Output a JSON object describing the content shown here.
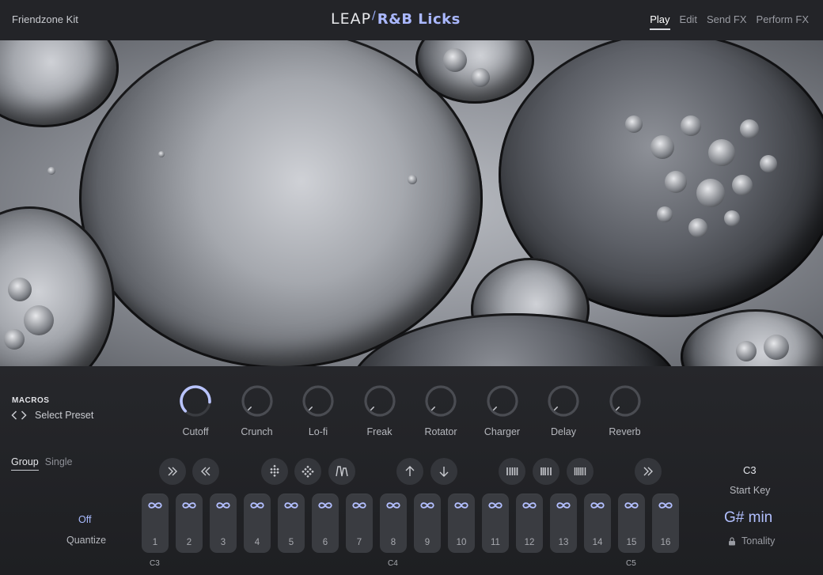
{
  "header": {
    "kit_name": "Friendzone Kit",
    "logo_brand": "LEAP",
    "logo_title": "R&B Licks",
    "nav_tabs": [
      {
        "label": "Play",
        "active": true
      },
      {
        "label": "Edit",
        "active": false
      },
      {
        "label": "Send FX",
        "active": false
      },
      {
        "label": "Perform FX",
        "active": false
      }
    ]
  },
  "macros": {
    "label": "MACROS",
    "preset_label": "Select Preset",
    "knobs": [
      {
        "label": "Cutoff",
        "value": 0.85
      },
      {
        "label": "Crunch",
        "value": 0.0
      },
      {
        "label": "Lo-fi",
        "value": 0.0
      },
      {
        "label": "Freak",
        "value": 0.0
      },
      {
        "label": "Rotator",
        "value": 0.0
      },
      {
        "label": "Charger",
        "value": 0.0
      },
      {
        "label": "Delay",
        "value": 0.0
      },
      {
        "label": "Reverb",
        "value": 0.0
      }
    ]
  },
  "mode_tabs": [
    {
      "label": "Group",
      "active": true
    },
    {
      "label": "Single",
      "active": false
    }
  ],
  "quantize": {
    "value": "Off",
    "label": "Quantize"
  },
  "controls": [
    {
      "icon": "double-chevron-right-icon"
    },
    {
      "icon": "double-chevron-left-icon"
    },
    {
      "icon": "diamond-grid-icon"
    },
    {
      "icon": "diamond-grid-alt-icon"
    },
    {
      "icon": "envelope-icon"
    },
    {
      "icon": "arrow-up-icon"
    },
    {
      "icon": "arrow-down-icon"
    },
    {
      "icon": "bars-icon"
    },
    {
      "icon": "bars-alt-icon"
    },
    {
      "icon": "bars-dense-icon"
    },
    {
      "icon": "double-chevron-right-icon"
    }
  ],
  "pads": [
    "1",
    "2",
    "3",
    "4",
    "5",
    "6",
    "7",
    "8",
    "9",
    "10",
    "11",
    "12",
    "13",
    "14",
    "15",
    "16"
  ],
  "octave_labels": [
    "C3",
    "C4",
    "C5"
  ],
  "start_key": {
    "value": "C3",
    "label": "Start Key"
  },
  "tonality": {
    "value": "G# min",
    "label": "Tonality"
  },
  "colors": {
    "accent": "#aab8ff",
    "panel": "#232428",
    "pad": "#3a3c41"
  }
}
